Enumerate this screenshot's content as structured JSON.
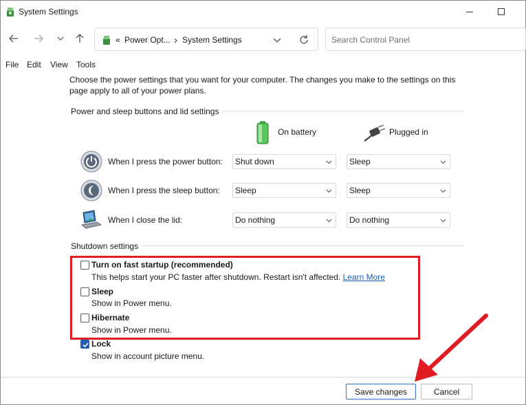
{
  "window": {
    "title": "System Settings"
  },
  "address": {
    "crumb1": "Power Opt...",
    "crumb2": "System Settings",
    "separator": "«"
  },
  "search": {
    "placeholder": "Search Control Panel"
  },
  "menu": [
    "File",
    "Edit",
    "View",
    "Tools"
  ],
  "intro": "Choose the power settings that you want for your computer. The changes you make to the settings on this page apply to all of your power plans.",
  "power_section": {
    "heading": "Power and sleep buttons and lid settings",
    "columns": {
      "battery": "On battery",
      "plugged": "Plugged in"
    },
    "rows": [
      {
        "label": "When I press the power button:",
        "battery": "Shut down",
        "plugged": "Sleep",
        "icon": "power-button-icon"
      },
      {
        "label": "When I press the sleep button:",
        "battery": "Sleep",
        "plugged": "Sleep",
        "icon": "sleep-button-icon"
      },
      {
        "label": "When I close the lid:",
        "battery": "Do nothing",
        "plugged": "Do nothing",
        "icon": "laptop-lid-icon"
      }
    ]
  },
  "shutdown_section": {
    "heading": "Shutdown settings",
    "options": [
      {
        "title": "Turn on fast startup (recommended)",
        "desc": "This helps start your PC faster after shutdown. Restart isn't affected.",
        "link": "Learn More",
        "checked": false
      },
      {
        "title": "Sleep",
        "desc": "Show in Power menu.",
        "checked": false
      },
      {
        "title": "Hibernate",
        "desc": "Show in Power menu.",
        "checked": false
      },
      {
        "title": "Lock",
        "desc": "Show in account picture menu.",
        "checked": true
      }
    ]
  },
  "buttons": {
    "save": "Save changes",
    "cancel": "Cancel"
  },
  "colors": {
    "highlight": "#e01b24",
    "arrow": "#e01b24",
    "checkbox_checked": "#1f5fb4",
    "link": "#1a5fb4"
  }
}
